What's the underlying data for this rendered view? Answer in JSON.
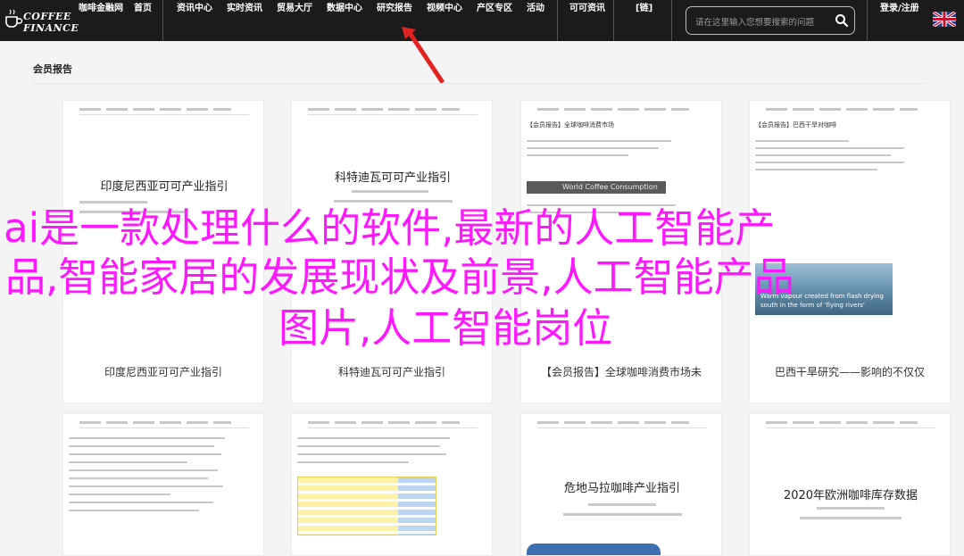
{
  "logo": {
    "line1": "COFFEE",
    "line2": "FINANCE"
  },
  "nav": {
    "items": [
      {
        "label": "咖啡金融网"
      },
      {
        "label": "首页"
      },
      {
        "label": "资讯中心"
      },
      {
        "label": "实时资讯"
      },
      {
        "label": "贸易大厅"
      },
      {
        "label": "数据中心"
      },
      {
        "label": "研究报告"
      },
      {
        "label": "视频中心"
      },
      {
        "label": "产区专区"
      },
      {
        "label": "活动"
      },
      {
        "label": "可可资讯"
      },
      {
        "label": "[链]"
      }
    ],
    "login": "登录/注册"
  },
  "search": {
    "placeholder": "请在这里输入您想要搜索的问题"
  },
  "section": {
    "title": "会员报告"
  },
  "cards_row1": [
    {
      "doc_title": "印度尼西亚可可产业指引",
      "caption": "印度尼西亚可可产业指引"
    },
    {
      "doc_title": "科特迪瓦可可产业指引",
      "caption": "科特迪瓦可可产业指引"
    },
    {
      "badge": "【会员报告】全球咖啡消费市场",
      "chart_label": "World Coffee Consumption",
      "caption": "【会员报告】全球咖啡消费市场未"
    },
    {
      "badge": "【会员报告】巴西干旱对咖啡",
      "photo_caption_1": "Warm vapour created from flash drying",
      "photo_caption_2": "south in the form of 'flying rivers'",
      "caption": "巴西干旱研究——影响的不仅仅"
    }
  ],
  "cards_row2": [
    {
      "doc_title": ""
    },
    {
      "doc_title": ""
    },
    {
      "doc_title": "危地马拉咖啡产业指引"
    },
    {
      "doc_title": "2020年欧洲咖啡库存数据"
    }
  ],
  "overlay": {
    "line1": "ai是一款处理什么的软件,最新的人工智能产",
    "line2": "品,智能家居的发展现状及前景,人工智能产品",
    "line3": "图片,人工智能岗位"
  },
  "colors": {
    "nav_bg": "#1b1b1b",
    "overlay_text": "#ff17ff",
    "arrow": "#e0231f"
  }
}
